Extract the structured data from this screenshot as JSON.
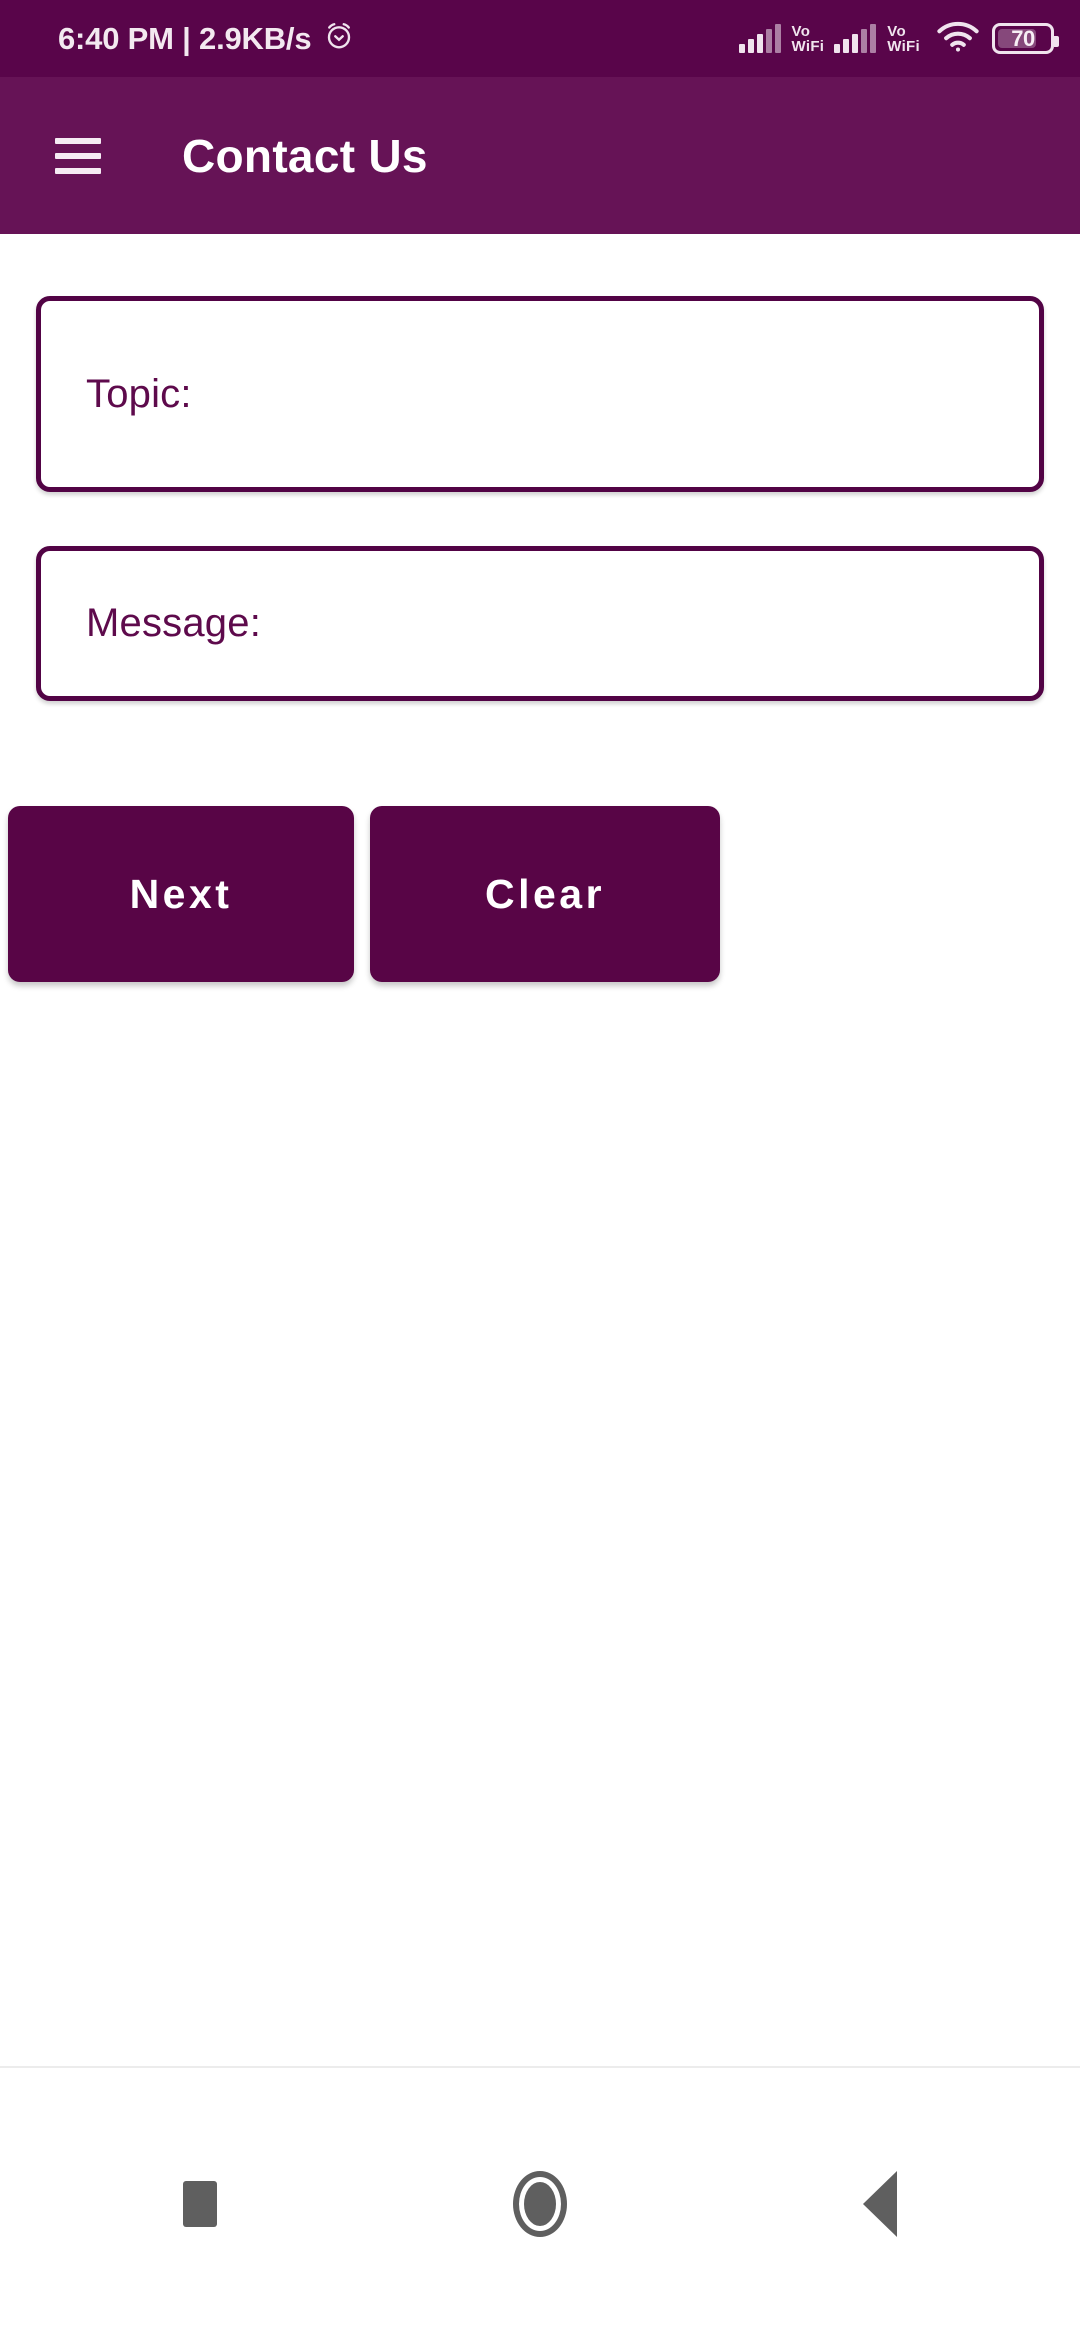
{
  "status_bar": {
    "time_and_speed": "6:40 PM | 2.9KB/s",
    "alarm_icon": "alarm-clock-icon",
    "signal_1": {
      "icon": "cellular-signal-icon",
      "label": "Vo WiFi",
      "label_line1": "Vo",
      "label_line2": "WiFi"
    },
    "signal_2": {
      "icon": "cellular-signal-icon",
      "label": "Vo WiFi",
      "label_line1": "Vo",
      "label_line2": "WiFi"
    },
    "wifi_icon": "wifi-icon",
    "battery_level": "70",
    "background_color": "#59054a"
  },
  "app_bar": {
    "menu_icon": "hamburger-menu-icon",
    "title": "Contact Us",
    "background_color": "#661356",
    "title_color": "#ffffff"
  },
  "form": {
    "fields": [
      {
        "name": "topic",
        "label": "Topic:",
        "value": "",
        "placeholder": ""
      },
      {
        "name": "message",
        "label": "Message:",
        "value": "",
        "placeholder": ""
      }
    ],
    "field_border_color": "#520345",
    "field_label_color": "#5e0a4c"
  },
  "buttons": {
    "next_label": "Next",
    "clear_label": "Clear",
    "background_color": "#580546",
    "text_color": "#ffffff"
  },
  "nav_bar": {
    "recents_icon": "square-recents-icon",
    "home_icon": "circle-home-icon",
    "back_icon": "triangle-back-icon",
    "icon_color": "#5f5f5f"
  }
}
